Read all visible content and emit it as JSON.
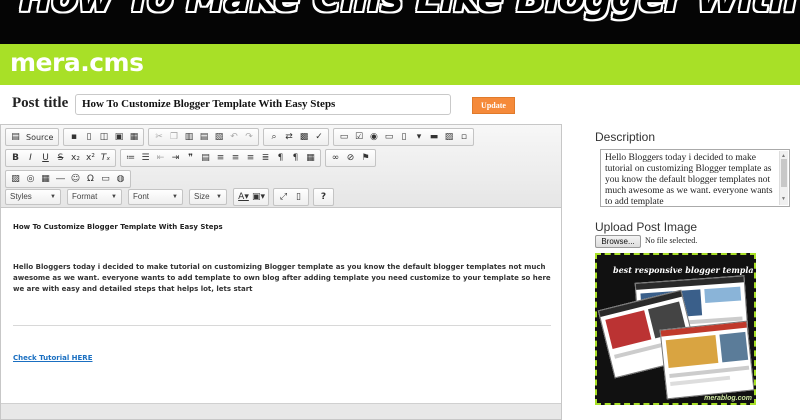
{
  "banner": {
    "title": "How To Make Cms Like Blogger With PHP PDO"
  },
  "brand": {
    "name": "mera.cms"
  },
  "post": {
    "title_label": "Post title",
    "title_value": "How To Customize Blogger Template With Easy Steps",
    "update_label": "Update"
  },
  "toolbar": {
    "source_label": "Source",
    "styles_label": "Styles",
    "format_label": "Format",
    "font_label": "Font",
    "size_label": "Size",
    "help_label": "?"
  },
  "editor": {
    "heading": "How To Customize Blogger Template With Easy Steps",
    "body": "Hello Bloggers today i decided  to make tutorial on customizing Blogger template as you know the default blogger templates not much awesome as we want. everyone wants to add template to own blog after adding template you need customize to your template so here we are with easy and detailed steps that helps lot, lets start",
    "link": "Check Tutorial HERE"
  },
  "sidebar": {
    "description_label": "Description",
    "description_value": "Hello Bloggers today i decided  to make tutorial on customizing Blogger template as you know the default blogger templates not much awesome as we want. everyone wants to add template",
    "upload_label": "Upload Post Image",
    "browse_label": "Browse...",
    "no_file_label": "No file selected.",
    "preview_title": "best responsive blogger templates",
    "preview_watermark": "merablog.com"
  },
  "colors": {
    "brand_green": "#a8e027",
    "update_orange": "#f58a3a",
    "link_blue": "#1a6fc1"
  }
}
